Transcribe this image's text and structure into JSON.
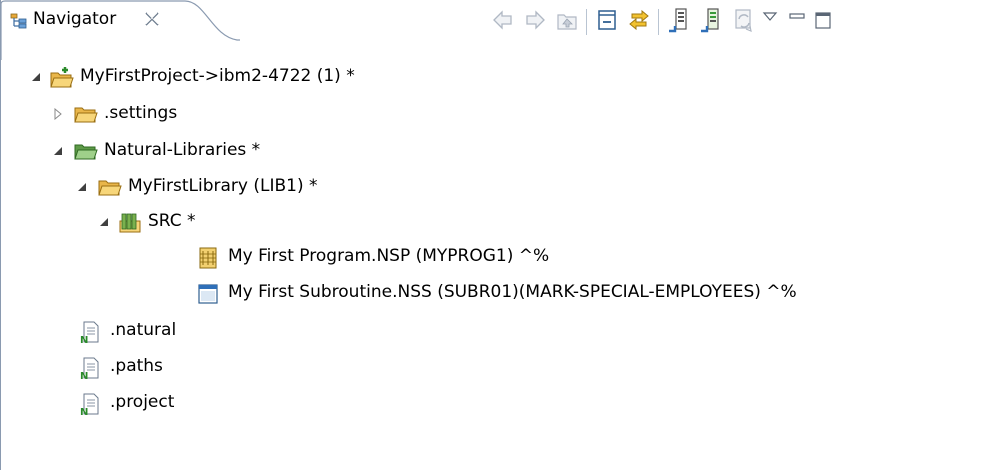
{
  "view": {
    "tab_label": "Navigator",
    "toolbar": [
      {
        "name": "back-icon"
      },
      {
        "name": "forward-icon"
      },
      {
        "name": "up-icon"
      },
      {
        "name": "collapse-all-icon"
      },
      {
        "name": "link-with-editor-icon"
      },
      {
        "name": "upload-icon"
      },
      {
        "name": "download-icon"
      },
      {
        "name": "refresh-icon"
      },
      {
        "name": "view-menu-icon"
      },
      {
        "name": "minimize-icon"
      },
      {
        "name": "maximize-icon"
      }
    ]
  },
  "tree": [
    {
      "label": "MyFirstProject->ibm2-4722 (1) *",
      "icon": "project-folder-icon",
      "toggle": "expanded"
    },
    {
      "label": ".settings",
      "icon": "folder-icon",
      "toggle": "collapsed"
    },
    {
      "label": "Natural-Libraries  *",
      "icon": "folder-open-icon",
      "toggle": "expanded"
    },
    {
      "label": "MyFirstLibrary (LIB1) *",
      "icon": "folder-open-icon",
      "toggle": "expanded"
    },
    {
      "label": "SRC  *",
      "icon": "source-group-icon",
      "toggle": "expanded"
    },
    {
      "label": "My First Program.NSP (MYPROG1) ^%",
      "icon": "program-icon",
      "toggle": "none"
    },
    {
      "label": "My First Subroutine.NSS (SUBR01)(MARK-SPECIAL-EMPLOYEES) ^%",
      "icon": "subroutine-icon",
      "toggle": "none"
    },
    {
      "label": ".natural",
      "icon": "natural-file-icon",
      "toggle": "none"
    },
    {
      "label": ".paths",
      "icon": "natural-file-icon",
      "toggle": "none"
    },
    {
      "label": ".project",
      "icon": "natural-file-icon",
      "toggle": "none"
    }
  ]
}
